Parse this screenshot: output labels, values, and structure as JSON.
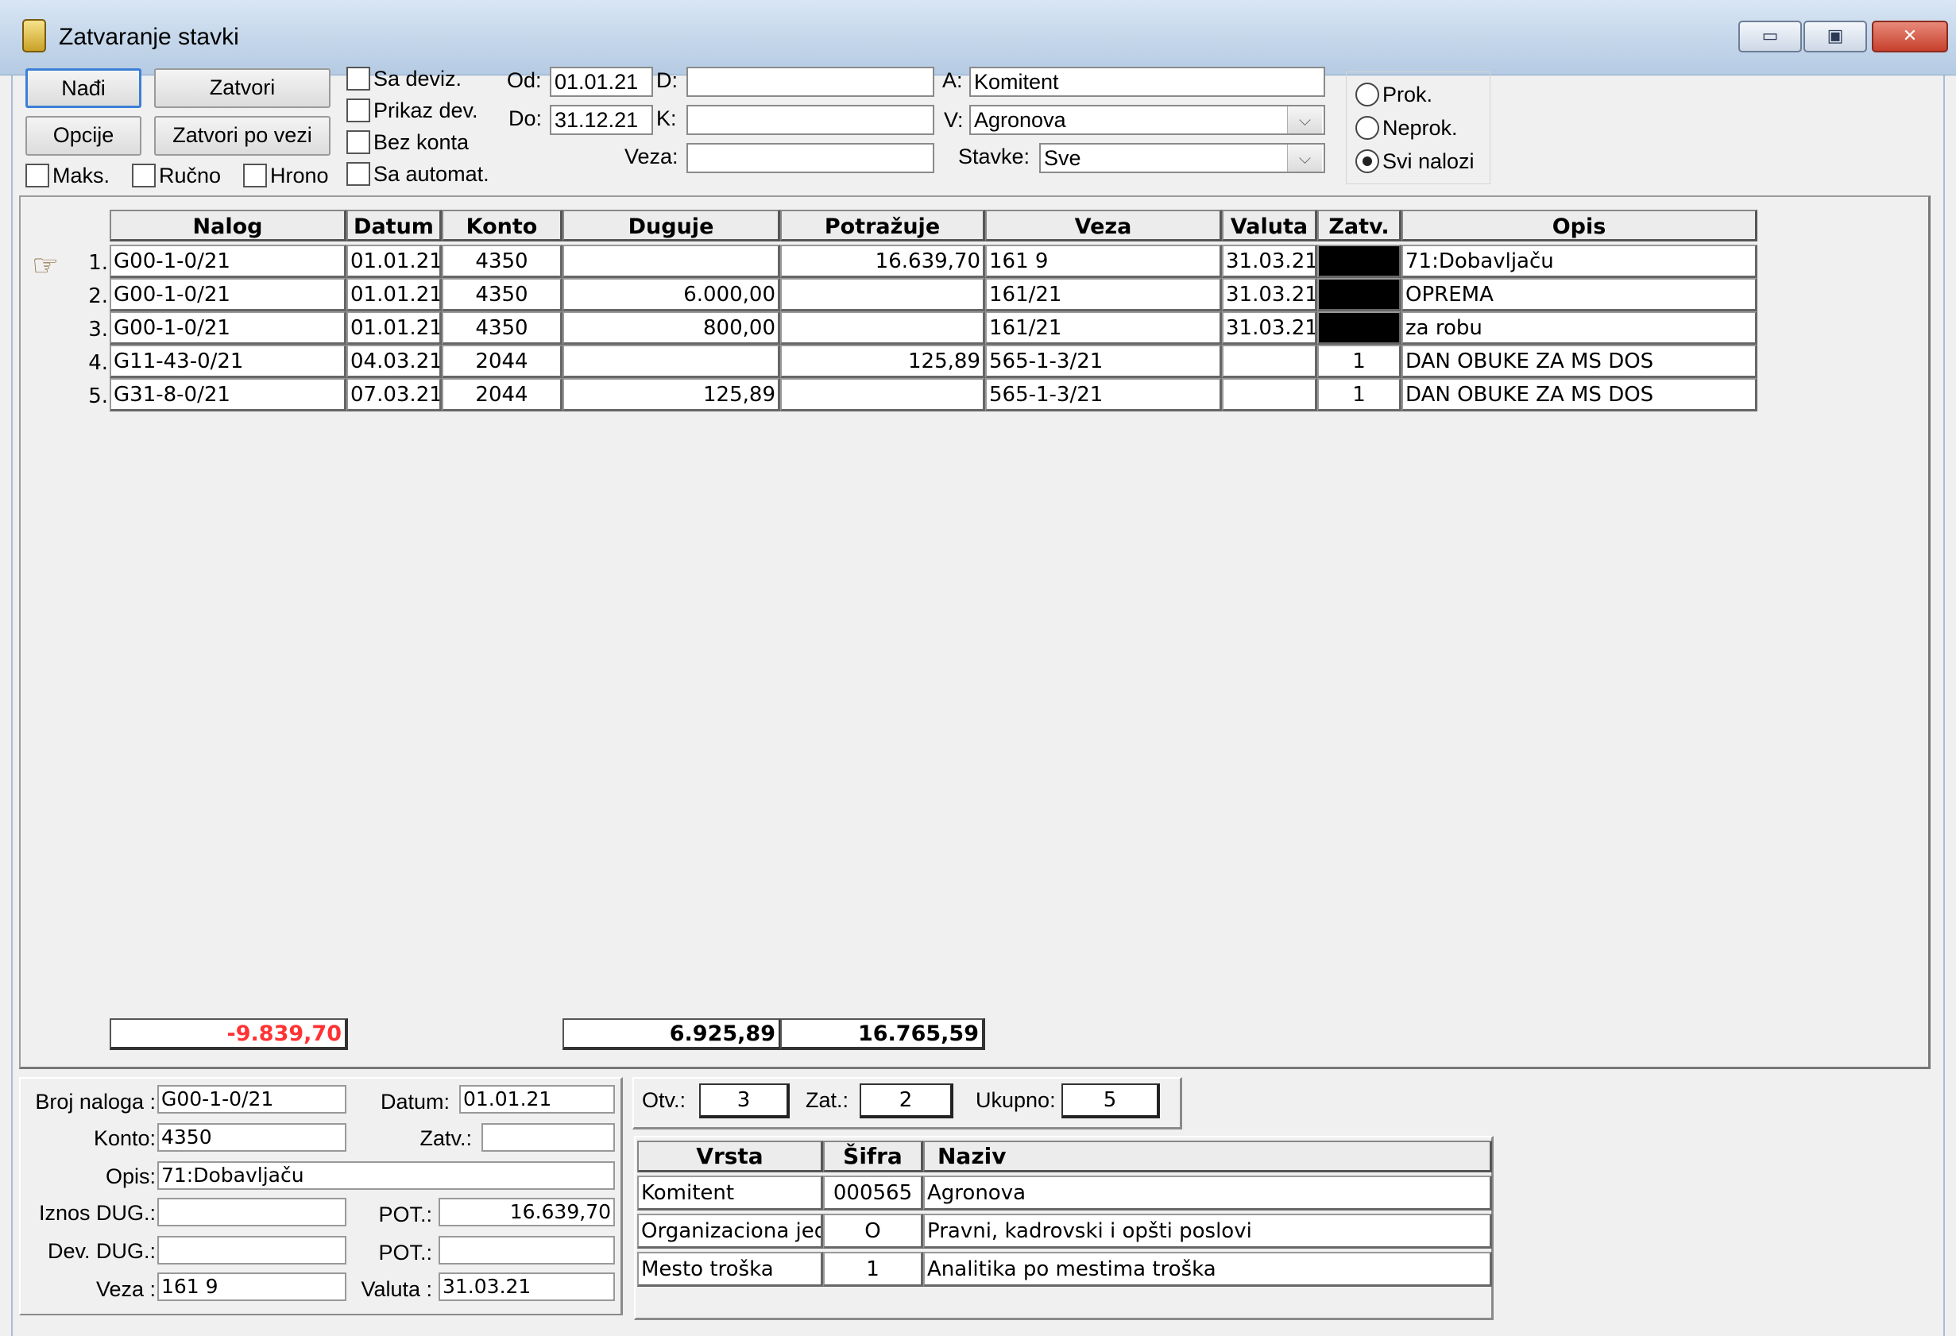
{
  "window": {
    "title": "Zatvaranje stavki",
    "minimize_symbol": "▭",
    "maximize_symbol": "▣",
    "close_symbol": "✕"
  },
  "toolbar": {
    "find_label": "Nađi",
    "close_label": "Zatvori",
    "options_label": "Opcije",
    "close_by_link_label": "Zatvori po vezi",
    "max_label": "Maks.",
    "manual_label": "Ručno",
    "chrono_label": "Hrono",
    "with_foreign_label": "Sa deviz.",
    "show_foreign_label": "Prikaz dev.",
    "no_account_label": "Bez konta",
    "with_auto_label": "Sa automat."
  },
  "filters": {
    "od_label": "Od:",
    "od_value": "01.01.21",
    "do_label": "Do:",
    "do_value": "31.12.21",
    "d_label": "D:",
    "d_value": "",
    "k_label": "K:",
    "k_value": "",
    "veza_label": "Veza:",
    "veza_value": "",
    "a_label": "A:",
    "a_value": "Komitent",
    "v_label": "V:",
    "v_value": "Agronova",
    "stavke_label": "Stavke:",
    "stavke_value": "Sve"
  },
  "radio": {
    "prok_label": "Prok.",
    "neprok_label": "Neprok.",
    "svi_label": "Svi nalozi",
    "selected": "Svi nalozi"
  },
  "grid": {
    "columns": [
      "Nalog",
      "Datum",
      "Konto",
      "Duguje",
      "Potražuje",
      "Veza",
      "Valuta",
      "Zatv.",
      "Opis"
    ],
    "rows": [
      {
        "num": "1.",
        "nalog": "G00-1-0/21",
        "datum": "01.01.21",
        "konto": "4350",
        "duguje": "",
        "potrazuje": "16.639,70",
        "veza": "161 9",
        "valuta": "31.03.21",
        "zatv": "",
        "opis": "71:Dobavljaču"
      },
      {
        "num": "2.",
        "nalog": "G00-1-0/21",
        "datum": "01.01.21",
        "konto": "4350",
        "duguje": "6.000,00",
        "potrazuje": "",
        "veza": "161/21",
        "valuta": "31.03.21",
        "zatv": "",
        "opis": "OPREMA"
      },
      {
        "num": "3.",
        "nalog": "G00-1-0/21",
        "datum": "01.01.21",
        "konto": "4350",
        "duguje": "800,00",
        "potrazuje": "",
        "veza": "161/21",
        "valuta": "31.03.21",
        "zatv": "",
        "opis": "za robu"
      },
      {
        "num": "4.",
        "nalog": "G11-43-0/21",
        "datum": "04.03.21",
        "konto": "2044",
        "duguje": "",
        "potrazuje": "125,89",
        "veza": "565-1-3/21",
        "valuta": "",
        "zatv": "1",
        "opis": "DAN OBUKE ZA MS DOS"
      },
      {
        "num": "5.",
        "nalog": "G31-8-0/21",
        "datum": "07.03.21",
        "konto": "2044",
        "duguje": "125,89",
        "potrazuje": "",
        "veza": "565-1-3/21",
        "valuta": "",
        "zatv": "1",
        "opis": "DAN OBUKE ZA MS DOS"
      }
    ],
    "current_row_icon": "pointing-hand-icon",
    "total_saldo": "-9.839,70",
    "total_saldo_color": "#ff3333",
    "total_duguje": "6.925,89",
    "total_potrazuje": "16.765,59"
  },
  "detail": {
    "broj_naloga_label": "Broj naloga :",
    "broj_naloga": "G00-1-0/21",
    "datum_label": "Datum:",
    "datum": "01.01.21",
    "konto_label": "Konto:",
    "konto": "4350",
    "zatv_label": "Zatv.:",
    "zatv": "",
    "opis_label": "Opis:",
    "opis": "71:Dobavljaču",
    "iznos_dug_label": "Iznos DUG.:",
    "iznos_dug": "",
    "pot_label": "POT.:",
    "pot": "16.639,70",
    "dev_dug_label": "Dev. DUG.:",
    "dev_dug": "",
    "dev_pot_label": "POT.:",
    "dev_pot": "",
    "veza_label": "Veza :",
    "veza": "161 9",
    "valuta_label": "Valuta :",
    "valuta": "31.03.21"
  },
  "counts": {
    "otv_label": "Otv.:",
    "otv": "3",
    "zat_label": "Zat.:",
    "zat": "2",
    "ukupno_label": "Ukupno:",
    "ukupno": "5"
  },
  "attributes": {
    "columns": [
      "Vrsta",
      "Šifra",
      "Naziv"
    ],
    "rows": [
      {
        "vrsta": "Komitent",
        "sifra": "000565",
        "naziv": "Agronova"
      },
      {
        "vrsta": "Organizaciona jedir",
        "sifra": "O",
        "naziv": "Pravni, kadrovski i opšti poslovi"
      },
      {
        "vrsta": "Mesto troška",
        "sifra": "1",
        "naziv": "Analitika po mestima troška"
      }
    ]
  }
}
